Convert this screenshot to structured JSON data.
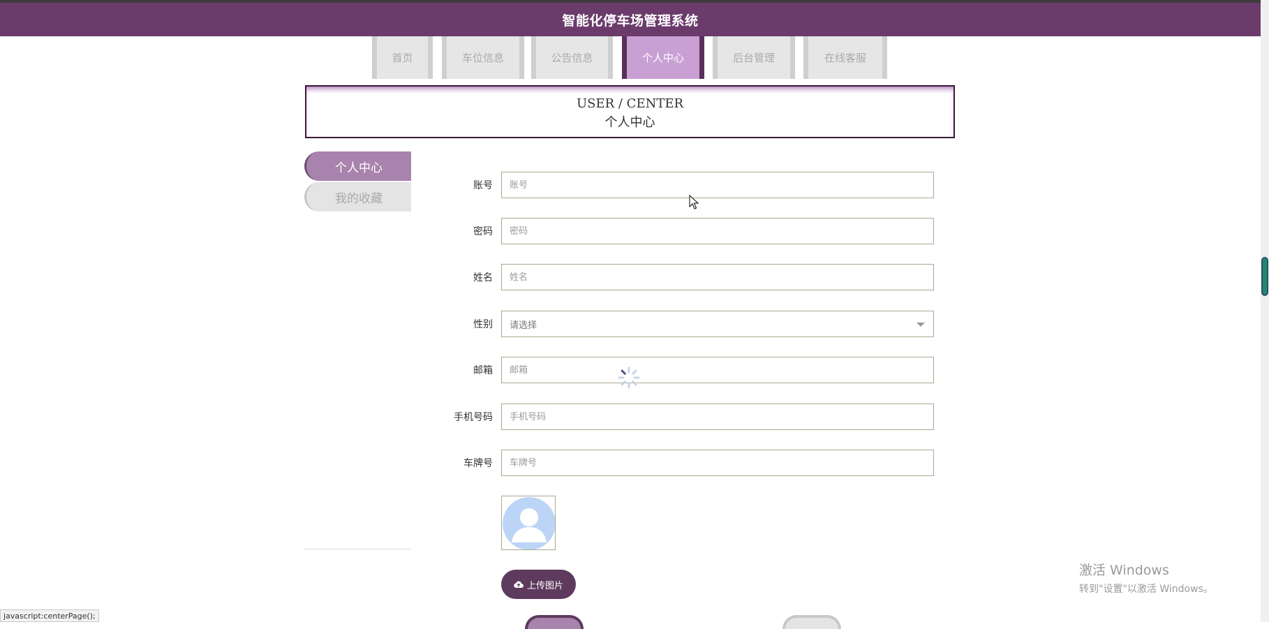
{
  "header": {
    "title": "智能化停车场管理系统"
  },
  "nav": {
    "tabs": [
      {
        "label": "首页"
      },
      {
        "label": "车位信息"
      },
      {
        "label": "公告信息"
      },
      {
        "label": "个人中心"
      },
      {
        "label": "后台管理"
      },
      {
        "label": "在线客服"
      }
    ]
  },
  "banner": {
    "en": "USER / CENTER",
    "cn": "个人中心"
  },
  "sidebar": {
    "items": [
      {
        "label": "个人中心"
      },
      {
        "label": "我的收藏"
      }
    ]
  },
  "form": {
    "account": {
      "label": "账号",
      "placeholder": "账号",
      "value": ""
    },
    "password": {
      "label": "密码",
      "placeholder": "密码",
      "value": ""
    },
    "name": {
      "label": "姓名",
      "placeholder": "姓名",
      "value": ""
    },
    "gender": {
      "label": "性别",
      "selected": "请选择"
    },
    "email": {
      "label": "邮箱",
      "placeholder": "邮箱",
      "value": ""
    },
    "phone": {
      "label": "手机号码",
      "placeholder": "手机号码",
      "value": ""
    },
    "plate": {
      "label": "车牌号",
      "placeholder": "车牌号",
      "value": ""
    },
    "upload_label": "上传图片"
  },
  "watermark": {
    "title": "激活 Windows",
    "subtitle": "转到\"设置\"以激活 Windows。"
  },
  "statusbar": {
    "text": "javascript:centerPage();"
  },
  "colors": {
    "header_bg": "#6b3b6b",
    "accent": "#c9a0d4",
    "sidebar_active": "#a883ad",
    "button_bg": "#5e3a5e"
  },
  "icons": {
    "upload": "cloud-upload-icon",
    "avatar": "user-avatar-icon",
    "loading": "spinner-icon",
    "cursor": "mouse-cursor-icon",
    "select": "chevron-down-icon"
  }
}
